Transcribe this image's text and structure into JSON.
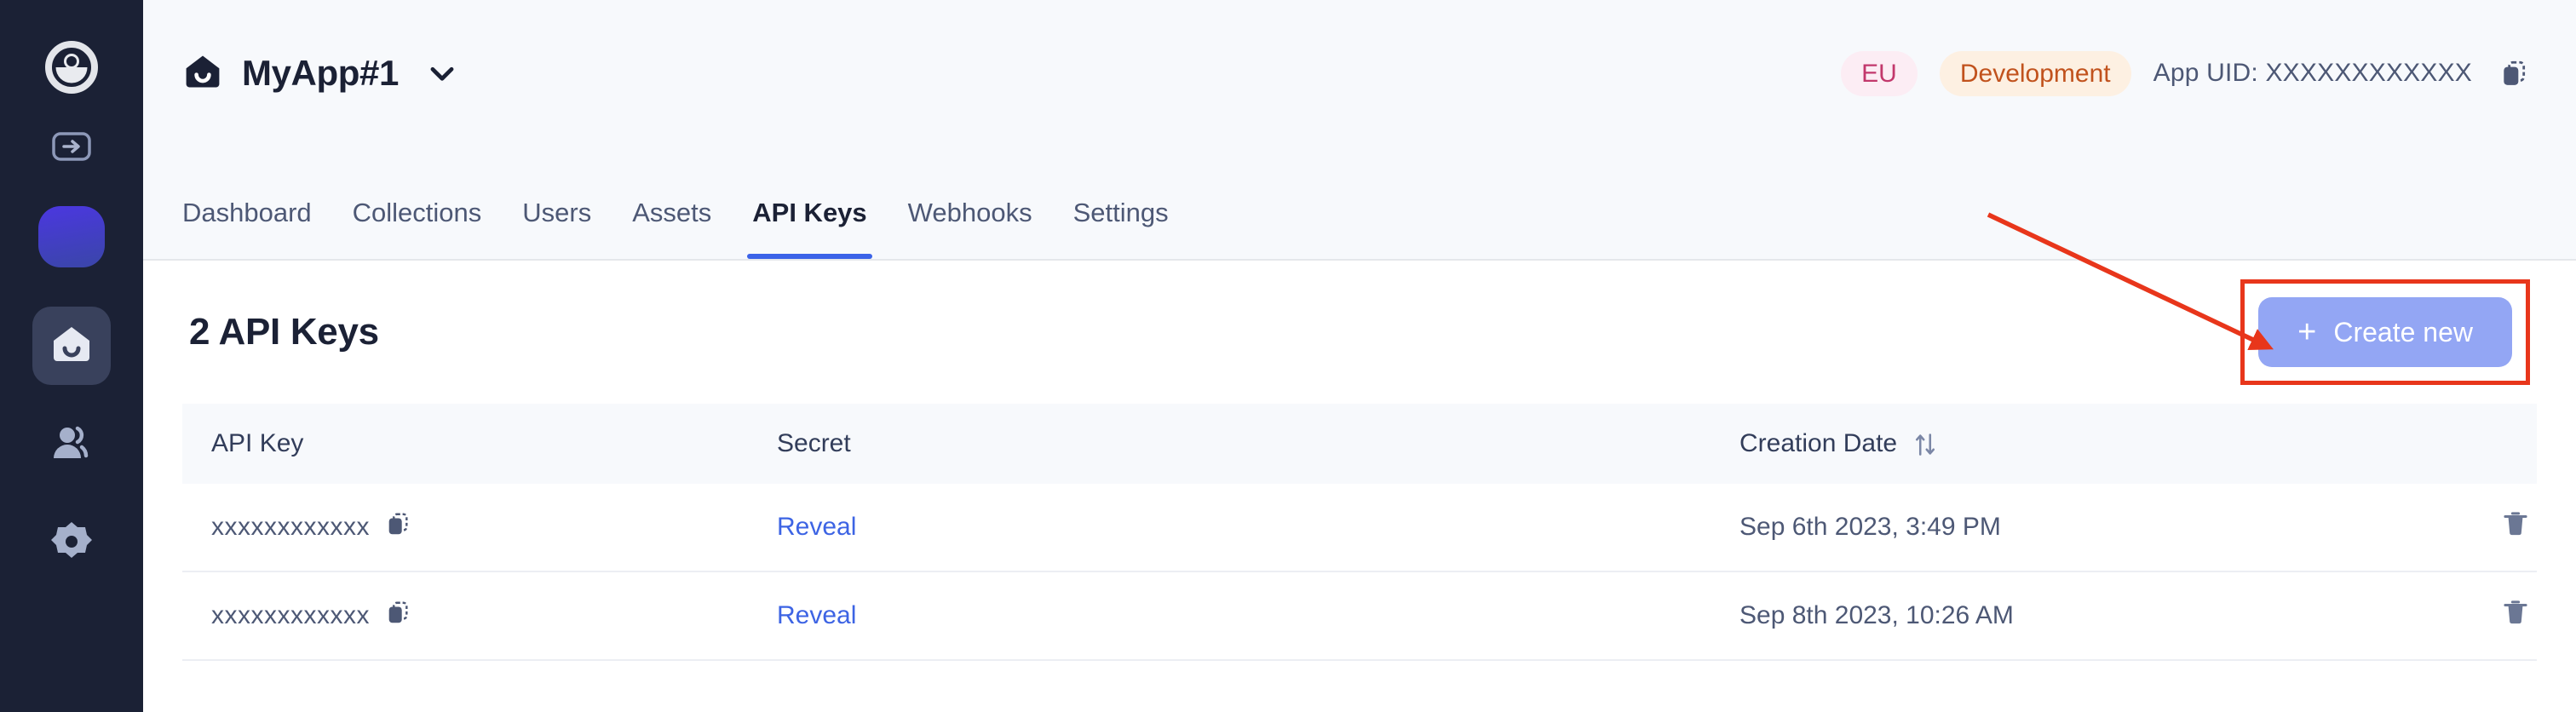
{
  "sidebar": {
    "brand_icon": "eye-logo-icon",
    "collapse_icon": "expand-panel-icon",
    "workspace_avatar": "workspace-avatar",
    "items": [
      {
        "icon": "apps-home-icon",
        "active": true
      },
      {
        "icon": "users-icon",
        "active": false
      },
      {
        "icon": "gear-icon",
        "active": false
      }
    ]
  },
  "header": {
    "app_icon": "app-home-icon",
    "app_name": "MyApp#1",
    "dropdown_icon": "chevron-down-icon",
    "region_badge": "EU",
    "env_badge": "Development",
    "app_uid_label": "App UID: XXXXXXXXXXXX",
    "copy_icon": "copy-icon"
  },
  "tabs": [
    {
      "label": "Dashboard",
      "active": false
    },
    {
      "label": "Collections",
      "active": false
    },
    {
      "label": "Users",
      "active": false
    },
    {
      "label": "Assets",
      "active": false
    },
    {
      "label": "API Keys",
      "active": true
    },
    {
      "label": "Webhooks",
      "active": false
    },
    {
      "label": "Settings",
      "active": false
    }
  ],
  "content": {
    "page_title": "2 API Keys",
    "create_button": {
      "label": "Create new",
      "plus_icon": "plus-icon"
    }
  },
  "table": {
    "columns": {
      "api_key": "API Key",
      "secret": "Secret",
      "creation_date": "Creation Date",
      "sort_icon": "sort-updown-icon",
      "actions": ""
    },
    "rows": [
      {
        "api_key": "xxxxxxxxxxxx",
        "copy_icon": "copy-icon",
        "secret_label": "Reveal",
        "creation_date": "Sep 6th 2023, 3:49 PM",
        "delete_icon": "trash-icon"
      },
      {
        "api_key": "xxxxxxxxxxxx",
        "copy_icon": "copy-icon",
        "secret_label": "Reveal",
        "creation_date": "Sep 8th 2023, 10:26 AM",
        "delete_icon": "trash-icon"
      }
    ]
  },
  "annotations": {
    "arrow_color": "#e8361b",
    "box_color": "#e8361b"
  },
  "colors": {
    "sidebar_bg": "#1b2135",
    "band_bg": "#f7f9fc",
    "accent_blue": "#3b63e8",
    "link_blue": "#3d64e4",
    "create_btn_bg": "#93a6f4",
    "badge_eu_bg": "#fcedf4",
    "badge_eu_fg": "#c2386c",
    "badge_env_bg": "#fdf0e2",
    "badge_env_fg": "#c1521d",
    "text_dark": "#1b2135",
    "text_muted": "#4d5875"
  }
}
